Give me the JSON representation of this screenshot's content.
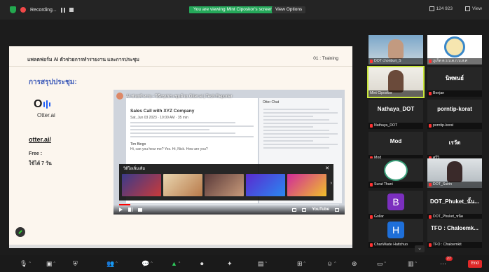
{
  "topbar": {
    "recording_label": "Recording...",
    "view_banner": "You are viewing Mint Ciposkor's screen",
    "view_options": "View Options",
    "right_label_1": "124 923",
    "right_label_2": "View"
  },
  "slide": {
    "title": "แพลตฟอร์ม AI ตัวช่วยการทำรายงาน และการประชุม",
    "slide_number": "01 : Training",
    "section_title": "การสรุปประชุม:",
    "otter_brand": "Otter.ai",
    "otter_link": "otter.ai/",
    "free_label": "Free :",
    "days_label": "ใช้ได้ 7 วัน"
  },
  "youtube": {
    "video_title": "AI ช่วยทำงาน - วิธีสรุปประชุมด้วย Otter.ai | Tech Reporter",
    "doc_heading": "Sales Call with XYZ Company",
    "doc_sub": "Sat, Jun 03 2023 · 10:00 AM · 35 min",
    "doc_sub2": "Tim Bingo",
    "doc_sub3": "Hi, can you hear me? Yes. Hi, Nick. How are you?",
    "side_header": "Otter Chat",
    "more_videos_label": "วิดีโอเพิ่มเติม",
    "logo_text": "YouTube",
    "progress": 0.05
  },
  "gallery": [
    {
      "name": "DOT chonburi_S"
    },
    {
      "name": "ภูเก็ต ต.ร.บ.ต.ก.บ.ส.ศ"
    },
    {
      "name": "Mint Ciposkor"
    },
    {
      "name": "Benjan",
      "big": "นิพพนธ์"
    },
    {
      "name": "Nathaya_DOT",
      "big": "Nathaya_DOT"
    },
    {
      "name": "porntip-korat",
      "big": "porntip-korat"
    },
    {
      "name": "Mod",
      "big": "Mod"
    },
    {
      "name": "ศรีวิ",
      "big": "เรวัต"
    },
    {
      "name": "Surat Thani"
    },
    {
      "name": "DOT_Suirin"
    },
    {
      "name": "Gollar",
      "letter": "B",
      "color": "#7b2fbe"
    },
    {
      "name": "DOT_Phuket_ชนิด",
      "big": "DOT_Phuket_นั้น..."
    },
    {
      "name": "ChanWade Hattchuo",
      "letter": "H",
      "color": "#1e6fd9"
    },
    {
      "name": "TFO : Chaloemkit",
      "big": "TFO : Chaloemk..."
    }
  ],
  "toolbar": {
    "chat_badge": "27",
    "end_label": "End"
  },
  "colors": {
    "accent_green": "#25a85a",
    "end_red": "#e02828",
    "section_blue": "#3b59b8",
    "active_border": "#c8e63c"
  }
}
